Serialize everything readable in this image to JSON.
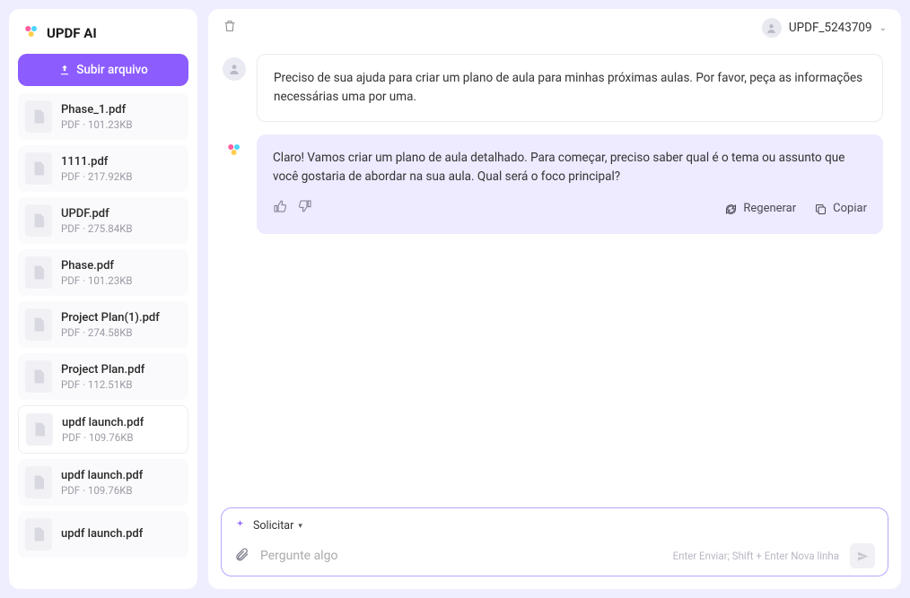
{
  "app": {
    "title": "UPDF AI"
  },
  "sidebar": {
    "upload_label": "Subir arquivo",
    "files": [
      {
        "name": "Phase_1.pdf",
        "meta": "PDF · 101.23KB"
      },
      {
        "name": "1111.pdf",
        "meta": "PDF · 217.92KB"
      },
      {
        "name": "UPDF.pdf",
        "meta": "PDF · 275.84KB"
      },
      {
        "name": "Phase.pdf",
        "meta": "PDF · 101.23KB"
      },
      {
        "name": "Project Plan(1).pdf",
        "meta": "PDF · 274.58KB"
      },
      {
        "name": "Project Plan.pdf",
        "meta": "PDF · 112.51KB"
      },
      {
        "name": "updf launch.pdf",
        "meta": "PDF · 109.76KB"
      },
      {
        "name": "updf launch.pdf",
        "meta": "PDF · 109.76KB"
      },
      {
        "name": "updf launch.pdf",
        "meta": ""
      }
    ]
  },
  "header": {
    "username": "UPDF_5243709"
  },
  "chat": {
    "messages": [
      {
        "role": "user",
        "text": "Preciso de sua ajuda para criar um plano de aula para minhas próximas aulas. Por favor, peça as informações necessárias uma por uma."
      },
      {
        "role": "ai",
        "text": "Claro! Vamos criar um plano de aula detalhado. Para começar, preciso saber qual é o tema ou assunto que você gostaria de abordar na sua aula. Qual será o foco principal?"
      }
    ],
    "actions": {
      "regenerate": "Regenerar",
      "copy": "Copiar"
    }
  },
  "input": {
    "solicitar_label": "Solicitar",
    "placeholder": "Pergunte algo",
    "hint": "Enter Enviar; Shift + Enter Nova linha"
  }
}
